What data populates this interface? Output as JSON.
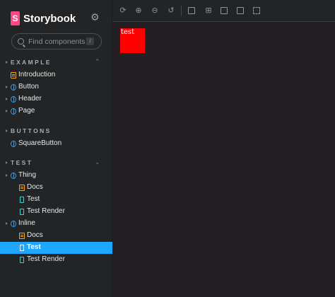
{
  "brand": {
    "title": "Storybook",
    "logo_letter": "S",
    "logo_color": "#ff4785"
  },
  "search": {
    "placeholder": "Find components",
    "shortcut": "/"
  },
  "icons": {
    "settings": "gear-icon",
    "search": "search-icon"
  },
  "sections": {
    "example": {
      "label": "EXAMPLE"
    },
    "buttons": {
      "label": "BUTTONS"
    },
    "test": {
      "label": "TEST"
    }
  },
  "tree": {
    "introduction": "Introduction",
    "button": "Button",
    "header": "Header",
    "page": "Page",
    "square_button": "SquareButton",
    "thing": "Thing",
    "thing_docs": "Docs",
    "thing_test": "Test",
    "thing_test_render": "Test Render",
    "inline": "Inline",
    "inline_docs": "Docs",
    "inline_test": "Test",
    "inline_test_render": "Test Render"
  },
  "selected_item": "Inline / Test",
  "toolbar": {
    "buttons": [
      "reload-icon",
      "zoom-in-icon",
      "zoom-out-icon",
      "zoom-reset-icon",
      "background-icon",
      "grid-icon",
      "viewport-icon",
      "measure-icon",
      "outline-icon"
    ]
  },
  "canvas": {
    "box_text": "test",
    "box_color": "#ff0000"
  },
  "colors": {
    "accent": "#1ea7fd",
    "sidebar_bg": "#222425",
    "canvas_bg": "#231f22"
  }
}
